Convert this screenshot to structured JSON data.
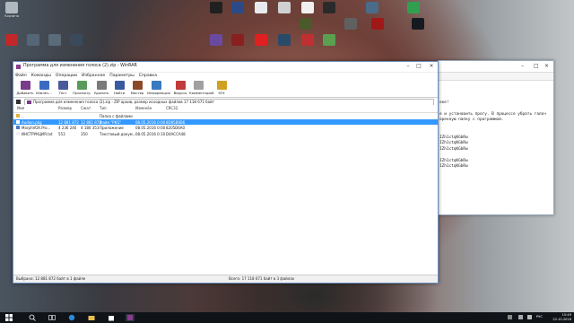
{
  "desktop": {
    "icons": [
      {
        "label": "Корзина",
        "color": "#b0b8c0"
      },
      {
        "label": "",
        "color": "#c0282a"
      },
      {
        "label": "",
        "color": "#556677"
      },
      {
        "label": "",
        "color": "#5a6b7a"
      },
      {
        "label": "",
        "color": "#3a4a5a"
      },
      {
        "label": "",
        "color": "#202020"
      },
      {
        "label": "",
        "color": "#2b4a8a"
      },
      {
        "label": "",
        "color": "#e8eaee"
      },
      {
        "label": "",
        "color": "#d0d0d0"
      },
      {
        "label": "",
        "color": "#f0f0f0"
      },
      {
        "label": "",
        "color": "#2a2a2a"
      },
      {
        "label": "",
        "color": "#6a4aa0"
      },
      {
        "label": "",
        "color": "#8a1f1f"
      },
      {
        "label": "",
        "color": "#e02020"
      },
      {
        "label": "",
        "color": "#2a4a6a"
      },
      {
        "label": "",
        "color": "#c03030"
      },
      {
        "label": "",
        "color": "#5aa050"
      },
      {
        "label": "",
        "color": "#4a6b8a"
      },
      {
        "label": "",
        "color": "#30a050"
      },
      {
        "label": "",
        "color": "#4a5a2a"
      },
      {
        "label": "",
        "color": "#606060"
      },
      {
        "label": "",
        "color": "#a01818"
      },
      {
        "label": "",
        "color": "#151a20"
      }
    ]
  },
  "notepad": {
    "lines": [
      "",
      "",
      "",
      "оке!",
      "",
      "е и установить прогу. В процессе убрать галоч",
      "оренную папку с программой.",
      "",
      "",
      "IZh1ctqKGbRw",
      "IZh1ctqKGbRw",
      "IZh1ctqKGbRw",
      "",
      "IZh1ctqKGbRw",
      "IZh1ctqKGbRw"
    ]
  },
  "winrar": {
    "title": "Программа для изменения голоса (2).zip - WinRAR",
    "menu": [
      "Файл",
      "Команды",
      "Операции",
      "Избранное",
      "Параметры",
      "Справка"
    ],
    "toolbar": [
      {
        "label": "Добавить",
        "color": "#7a3b8a"
      },
      {
        "label": "Извлеч...",
        "color": "#3a6bc0"
      },
      {
        "label": "Тест",
        "color": "#4a5a9a"
      },
      {
        "label": "Просмотр",
        "color": "#5a9a5a"
      },
      {
        "label": "Удалить",
        "color": "#7a7a7a"
      },
      {
        "label": "Найти",
        "color": "#3a5aa0"
      },
      {
        "label": "Мастер",
        "color": "#8a4a2a"
      },
      {
        "label": "Информация",
        "color": "#3a7ac0"
      },
      {
        "label": "Вирусы",
        "color": "#c03a3a"
      },
      {
        "label": "Комментарий",
        "color": "#a0a0a0"
      },
      {
        "label": "SFX",
        "color": "#d0a020"
      }
    ],
    "address": "Программа для изменения голоса (2).zip - ZIP архив, размер исходных файлов 17 118 671 байт",
    "columns": [
      "Имя",
      "Размер",
      "Сжат",
      "Тип",
      "Изменён",
      "CRC32"
    ],
    "rows": [
      {
        "name": "..",
        "size": "",
        "packed": "",
        "type": "Папка с файлами",
        "modified": "",
        "crc": "",
        "selected": false,
        "icon": "#e0b040"
      },
      {
        "name": "Audion.pkg",
        "size": "12 881 872",
        "packed": "12 881 872",
        "type": "Файл \"PKG\"",
        "modified": "08.05.2016 0:00",
        "crc": "8D85B6B6",
        "selected": true,
        "icon": "#ffffff"
      },
      {
        "name": "MorphVOX.Pro...",
        "size": "4 236 246",
        "packed": "4 180 353",
        "type": "Приложение",
        "modified": "08.05.2016 0:00",
        "crc": "8205D6A0",
        "selected": false,
        "icon": "#4a7ac0"
      },
      {
        "name": "ИНСТРУКЦИЯ.txt",
        "size": "553",
        "packed": "350",
        "type": "Текстовый докум...",
        "modified": "08.05.2016 0:10",
        "crc": "D4ACCA48",
        "selected": false,
        "icon": "#f0f0f0"
      }
    ],
    "status_left": "Выбрано: 12 881 872 байт в 1 файле",
    "status_right": "Всего: 17 118 671 байт в 3 файлах"
  },
  "taskbar": {
    "clock_time": "15:49",
    "clock_date": "22.10.2016",
    "lang": "РУС"
  }
}
